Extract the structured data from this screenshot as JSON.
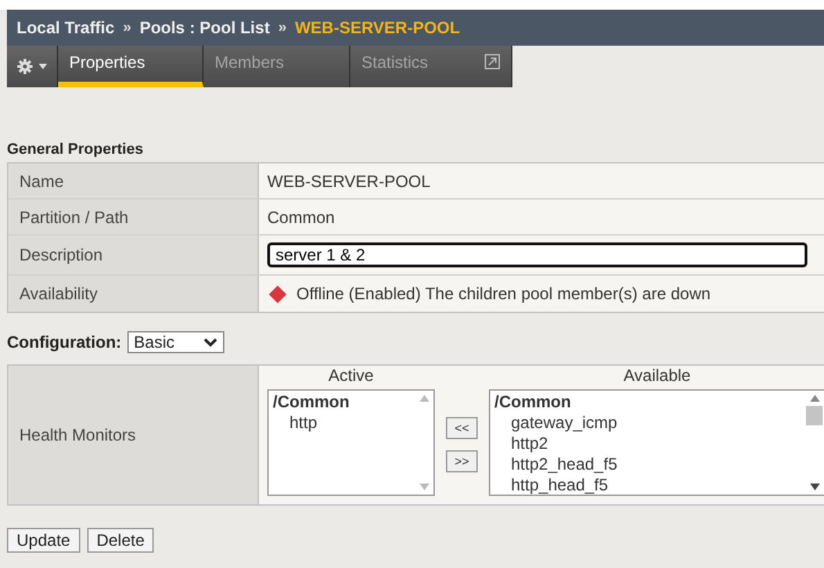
{
  "breadcrumb": {
    "items": [
      {
        "text": "Local Traffic",
        "current": false
      },
      {
        "text": "Pools : Pool List",
        "current": false
      },
      {
        "text": "WEB-SERVER-POOL",
        "current": true
      }
    ],
    "separators": [
      "»",
      "»"
    ]
  },
  "tabs": [
    {
      "label": "Properties",
      "selected": true,
      "popout": false
    },
    {
      "label": "Members",
      "selected": false,
      "popout": false
    },
    {
      "label": "Statistics",
      "selected": false,
      "popout": true
    }
  ],
  "section_title": "General Properties",
  "properties": [
    {
      "label": "Name",
      "value": "WEB-SERVER-POOL",
      "kind": "text"
    },
    {
      "label": "Partition / Path",
      "value": "Common",
      "kind": "text"
    },
    {
      "label": "Description",
      "value": "server 1 & 2",
      "kind": "input"
    },
    {
      "label": "Availability",
      "value": "Offline (Enabled) The children pool member(s) are down",
      "kind": "status",
      "color": "#d9363e"
    }
  ],
  "configuration": {
    "label": "Configuration:",
    "value": "Basic"
  },
  "health_monitors": {
    "label": "Health Monitors",
    "active": {
      "heading": "Active",
      "thumb": false,
      "items": [
        {
          "text": "/Common",
          "children": [
            {
              "text": "http"
            }
          ]
        }
      ]
    },
    "available": {
      "heading": "Available",
      "thumb": true,
      "items": [
        {
          "text": "/Common",
          "children": [
            {
              "text": "gateway_icmp"
            },
            {
              "text": "http2"
            },
            {
              "text": "http2_head_f5"
            },
            {
              "text": "http_head_f5"
            }
          ]
        }
      ]
    },
    "move_buttons": [
      "<<",
      ">>"
    ]
  },
  "actions": [
    "Update",
    "Delete"
  ]
}
